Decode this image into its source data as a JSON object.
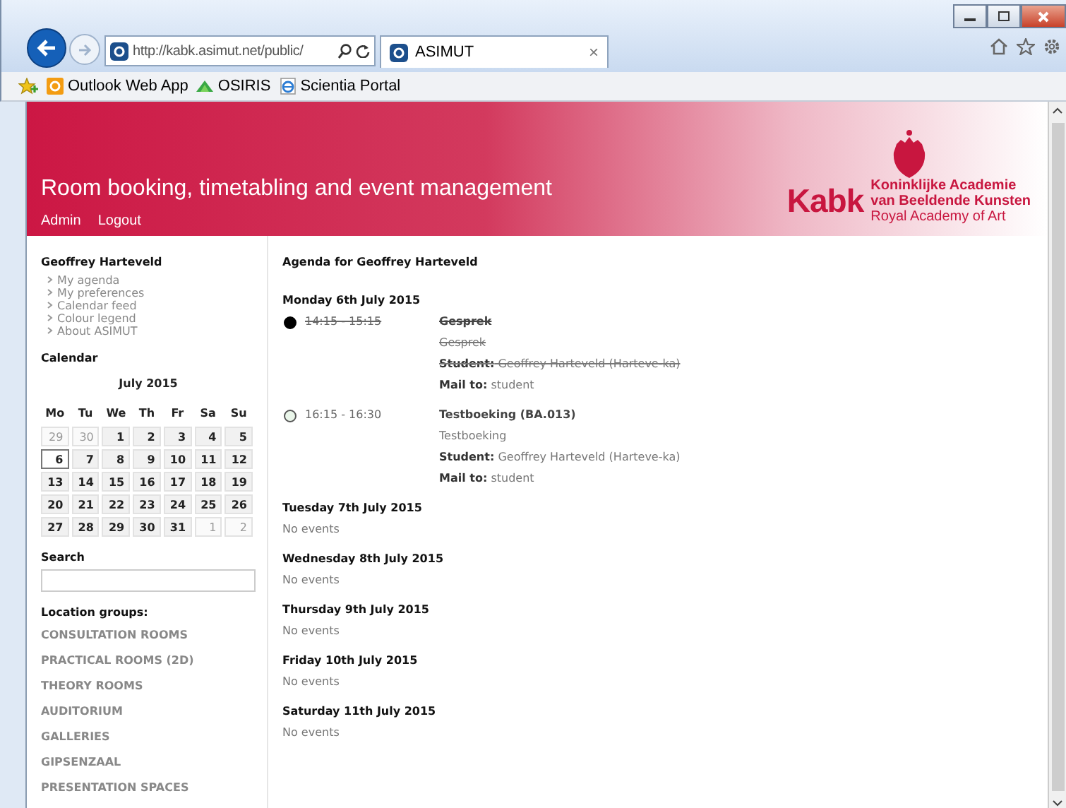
{
  "browser": {
    "url": "http://kabk.asimut.net/public/",
    "tab": {
      "title": "ASIMUT",
      "close": "×",
      "selected": true
    },
    "favorites": [
      {
        "label": "Outlook Web App",
        "kind": "outlook"
      },
      {
        "label": "OSIRIS",
        "kind": "osiris"
      },
      {
        "label": "Scientia Portal",
        "kind": "ie"
      }
    ]
  },
  "header": {
    "title": "Room booking, timetabling and event management",
    "nav": [
      "Admin",
      "Logout"
    ],
    "logo": {
      "mark": "Kabk",
      "lines": [
        "Koninklijke Academie",
        "van Beeldende Kunsten"
      ],
      "subline": "Royal Academy of Art"
    }
  },
  "sidebar": {
    "user": "Geoffrey Harteveld",
    "links": [
      "My agenda",
      "My preferences",
      "Calendar feed",
      "Colour legend",
      "About ASIMUT"
    ],
    "calendar": {
      "heading": "Calendar",
      "month": "July 2015",
      "weekdays": [
        "Mo",
        "Tu",
        "We",
        "Th",
        "Fr",
        "Sa",
        "Su"
      ],
      "weeks": [
        [
          {
            "day": "29",
            "other_month": true,
            "selected": false
          },
          {
            "day": "30",
            "other_month": true,
            "selected": false
          },
          {
            "day": "1",
            "other_month": false,
            "selected": false
          },
          {
            "day": "2",
            "other_month": false,
            "selected": false
          },
          {
            "day": "3",
            "other_month": false,
            "selected": false
          },
          {
            "day": "4",
            "other_month": false,
            "selected": false
          },
          {
            "day": "5",
            "other_month": false,
            "selected": false
          }
        ],
        [
          {
            "day": "6",
            "other_month": false,
            "selected": true
          },
          {
            "day": "7",
            "other_month": false,
            "selected": false
          },
          {
            "day": "8",
            "other_month": false,
            "selected": false
          },
          {
            "day": "9",
            "other_month": false,
            "selected": false
          },
          {
            "day": "10",
            "other_month": false,
            "selected": false
          },
          {
            "day": "11",
            "other_month": false,
            "selected": false
          },
          {
            "day": "12",
            "other_month": false,
            "selected": false
          }
        ],
        [
          {
            "day": "13",
            "other_month": false,
            "selected": false
          },
          {
            "day": "14",
            "other_month": false,
            "selected": false
          },
          {
            "day": "15",
            "other_month": false,
            "selected": false
          },
          {
            "day": "16",
            "other_month": false,
            "selected": false
          },
          {
            "day": "17",
            "other_month": false,
            "selected": false
          },
          {
            "day": "18",
            "other_month": false,
            "selected": false
          },
          {
            "day": "19",
            "other_month": false,
            "selected": false
          }
        ],
        [
          {
            "day": "20",
            "other_month": false,
            "selected": false
          },
          {
            "day": "21",
            "other_month": false,
            "selected": false
          },
          {
            "day": "22",
            "other_month": false,
            "selected": false
          },
          {
            "day": "23",
            "other_month": false,
            "selected": false
          },
          {
            "day": "24",
            "other_month": false,
            "selected": false
          },
          {
            "day": "25",
            "other_month": false,
            "selected": false
          },
          {
            "day": "26",
            "other_month": false,
            "selected": false
          }
        ],
        [
          {
            "day": "27",
            "other_month": false,
            "selected": false
          },
          {
            "day": "28",
            "other_month": false,
            "selected": false
          },
          {
            "day": "29",
            "other_month": false,
            "selected": false
          },
          {
            "day": "30",
            "other_month": false,
            "selected": false
          },
          {
            "day": "31",
            "other_month": false,
            "selected": false
          },
          {
            "day": "1",
            "other_month": true,
            "selected": false
          },
          {
            "day": "2",
            "other_month": true,
            "selected": false
          }
        ]
      ]
    },
    "search": {
      "label": "Search"
    },
    "location_groups": {
      "heading": "Location groups:",
      "items": [
        "CONSULTATION ROOMS",
        "PRACTICAL ROOMS (2D)",
        "THEORY ROOMS",
        "AUDITORIUM",
        "GALLERIES",
        "GIPSENZAAL",
        "PRESENTATION SPACES"
      ]
    }
  },
  "agenda": {
    "title": "Agenda for Geoffrey Harteveld",
    "days": [
      {
        "heading": "Monday 6th July 2015",
        "events": [
          {
            "time": "14:15 - 15:15",
            "title": "Gesprek",
            "description": "Gesprek",
            "student_label": "Student:",
            "student": "Geoffrey Harteveld (Harteve-ka)",
            "mail_label": "Mail to:",
            "mail": "student",
            "cancelled": true
          },
          {
            "time": "16:15 - 16:30",
            "title": "Testboeking (BA.013)",
            "description": "Testboeking",
            "student_label": "Student:",
            "student": "Geoffrey Harteveld (Harteve-ka)",
            "mail_label": "Mail to:",
            "mail": "student",
            "cancelled": false
          }
        ]
      },
      {
        "heading": "Tuesday 7th July 2015",
        "empty": "No events"
      },
      {
        "heading": "Wednesday 8th July 2015",
        "empty": "No events"
      },
      {
        "heading": "Thursday 9th July 2015",
        "empty": "No events"
      },
      {
        "heading": "Friday 10th July 2015",
        "empty": "No events"
      },
      {
        "heading": "Saturday 11th July 2015",
        "empty": "No events"
      }
    ]
  }
}
